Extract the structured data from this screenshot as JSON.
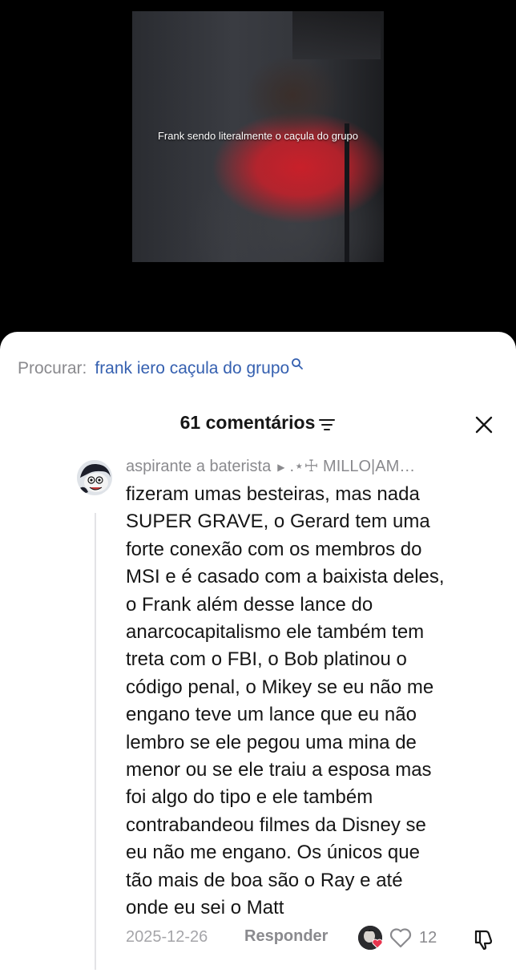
{
  "video": {
    "caption": "Frank sendo literalmente o caçula do grupo"
  },
  "search": {
    "label": "Procurar:",
    "term": "frank iero caçula do grupo"
  },
  "comments_header": {
    "count_label": "61 comentários"
  },
  "comment": {
    "author": "aspirante a baterista",
    "reply_to": ".⋆☩ MILLO|AM…",
    "text": "fizeram umas besteiras, mas nada\nSUPER GRAVE, o Gerard tem uma\nforte conexão com os membros do\nMSI e é casado com a baixista deles,\no Frank além desse lance do\nanarcocapitalismo ele também tem\ntreta com o FBI, o Bob platinou o\ncódigo penal, o Mikey se eu não me\nengano teve um lance que eu não\nlembro se ele pegou uma mina de\nmenor ou se ele traiu a esposa mas\nfoi algo do tipo e ele também\ncontrabandeou filmes da Disney se\neu não me engano. Os únicos que\ntão mais de boa são o Ray e até\nonde eu sei o Matt",
    "date": "2025-12-26",
    "reply_label": "Responder",
    "like_count": "12"
  },
  "colors": {
    "link": "#3560b0",
    "muted": "#8a8a8e",
    "heart": "#e8344e"
  }
}
